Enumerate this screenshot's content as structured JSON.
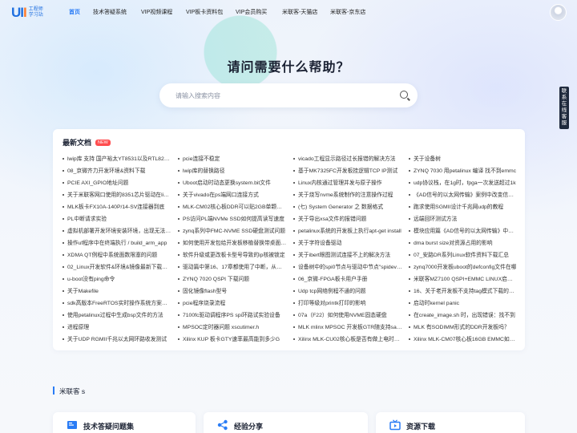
{
  "logo": {
    "mark_a": "UI",
    "mark_b": "I",
    "text": "工程师学习站"
  },
  "nav": [
    {
      "label": "首页",
      "active": true
    },
    {
      "label": "技术答疑系统",
      "active": false
    },
    {
      "label": "VIP视频课程",
      "active": false
    },
    {
      "label": "VIP板卡资料包",
      "active": false
    },
    {
      "label": "VIP会员购买",
      "active": false
    },
    {
      "label": "米联客-天猫店",
      "active": false
    },
    {
      "label": "米联客-京东店",
      "active": false
    }
  ],
  "hero": {
    "title": "请问需要什么帮助？"
  },
  "search": {
    "placeholder": "请输入搜索内容"
  },
  "side_tab": {
    "label": "联系在线客服"
  },
  "docs": {
    "title": "最新文档",
    "badge": "NEW",
    "items": [
      "lwip库 支持 国产裕太YT8531以及RTL8211F",
      "pcie连接不稳定",
      "vicado工程显示路径过长报错的解决方法",
      "关于设备树",
      "08_京微齐力开发环境&资料下载",
      "lwip库的替换路径",
      "基于MK7325FC开发板挂逻辑TCP IP测试",
      "ZYNQ 7030 用petalinux 编译 找不到emmc",
      "PCIE AXI_GPIO地址问题",
      "Uboot启动时动态更换system.bit文件",
      "Linux内核通过管理并发与原子操作",
      "udp协议栈，在1g时，fpga一次发送超过1k",
      "关于米联客网口使用的8351芯片驱动在linux下",
      "关于vivado在ps端网口连接方式",
      "关于烧写nvme系统制作的注意操作过程",
      "《AD信号的以太网传输》案例中改变信号源",
      "MLK板卡FX10A-140P/14-SV连接器到底",
      "MLK-CM02核心板DDR可以贴2GB单颗粒吗",
      "(七) System Generator 之 数据格式",
      "跑求使用SGMII设计千兆网udp的教程",
      "PL中断请求实验",
      "PS访问PL端NVMe SSD如何提高读写速度",
      "关于导出xsa文件的报错问题",
      "远端回环测试方法",
      "虚拟机部署开发环境安装环境，出现无法启动",
      "zynq系列中FMC-NVME SSD硬盘测试问题",
      "petalinux系统的开发板上执行apt-get install",
      "模块应用篇《AD信号的以太网传输》中的问题",
      "操作uf程序中在终端执行 / build_arm_app",
      "如何使用开发包给开发板移植替换带桌面系统",
      "关于字符设备驱动",
      "dma burst size对资源占用的影响",
      "XDMA QT例程中系统面数限塞的问题",
      "软件升级或更改板卡型号导致的ip核被锁定",
      "关于ibert眼图测试连接不上的解决方法",
      "07_安路DR系列Linux软件资料下载汇总",
      "02_Linux开发软件&环境&镜像最新下载地址",
      "驱动篇中第16、17章都使用了中断，从何获取",
      "设备树中的spi0节点与驱动中节点\"spidev\"的匹配",
      "zynq7000开发板uboot的defconfig文件在哪",
      "u-boot没有ping命令",
      "ZYNQ 7020 QSPI 下载问题",
      "06_京微-FPGA板卡用户手册",
      "米联客MZ7100 QSPI+EMMC LINUX启动问题",
      "关于Makefile",
      "固化镜像flash型号",
      "Udp tcp网络例程不通的问题",
      "16、关于老开发板不支持tag模式下载的问题",
      "sdk高版本FreeRTOS实时操作系统方案移植",
      "pcie程序烧录流程",
      "打印等级对printk打印的影响",
      "启动时kernel panic",
      "使用petalinux过程中生成bsp文件的方法",
      "7100fc驱动调程序PS spi环路试实验设备",
      "07a（F22）如何使用NVME固态硬盘",
      "在create_image.sh 时，出现错误：找不到",
      "进程原理",
      "MPSOC定时器问题 xscutimer.h",
      "MLK mlinx MPSOC 开发板GTR随支持sata协议",
      "MLK 有SODIMM形式的DDR开发板吗？",
      "关于UDP RGMII千兆以太网环路收发测试",
      "Xilinx KUP 板卡GTY速率最高能到多少G",
      "Xilinx MLK-CU02核心板是否有做上电时序测试",
      "Xilinx MLK-CM07核心板16GB EMMC如何使用"
    ]
  },
  "section": {
    "title": "米联客 s"
  },
  "cards": [
    {
      "label": "技术答疑问题集",
      "icon": "book-icon",
      "color": "#2a7cf5"
    },
    {
      "label": "经验分享",
      "icon": "share-icon",
      "color": "#2a7cf5"
    },
    {
      "label": "资源下载",
      "icon": "tv-icon",
      "color": "#2a7cf5"
    }
  ]
}
